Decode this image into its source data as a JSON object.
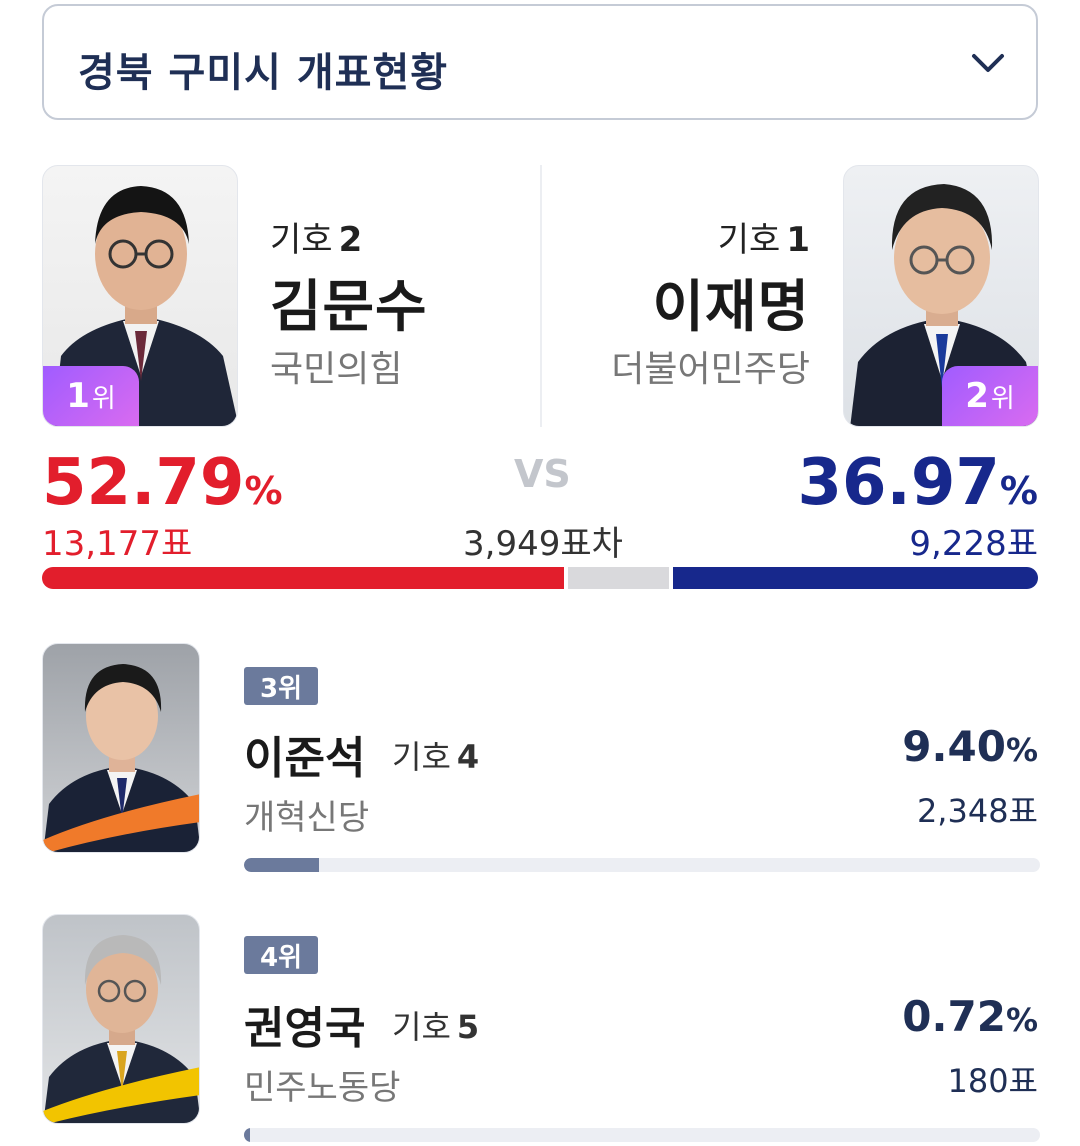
{
  "header": {
    "title": "경북 구미시 개표현황",
    "icon": "chevron-down-icon"
  },
  "top_candidates": [
    {
      "rank_number": "1",
      "rank_label": "위",
      "number_label": "기호",
      "number": "2",
      "name": "김문수",
      "party": "국민의힘",
      "percent": "52.79",
      "percent_sign": "%",
      "votes": "13,177표",
      "color": "#e21e2c",
      "vote_share": 52.79
    },
    {
      "rank_number": "2",
      "rank_label": "위",
      "number_label": "기호",
      "number": "1",
      "name": "이재명",
      "party": "더불어민주당",
      "percent": "36.97",
      "percent_sign": "%",
      "votes": "9,228표",
      "color": "#17288c",
      "vote_share": 36.97
    }
  ],
  "versus": {
    "label": "VS",
    "gap": "3,949표차"
  },
  "other_candidates": [
    {
      "rank": "3위",
      "name": "이준석",
      "number_label": "기호",
      "number": "4",
      "party": "개혁신당",
      "percent": "9.40",
      "percent_sign": "%",
      "votes": "2,348표",
      "vote_share": 9.4,
      "accent": "#f07a2a"
    },
    {
      "rank": "4위",
      "name": "권영국",
      "number_label": "기호",
      "number": "5",
      "party": "민주노동당",
      "percent": "0.72",
      "percent_sign": "%",
      "votes": "180표",
      "vote_share": 0.72,
      "accent": "#f2c400"
    }
  ]
}
